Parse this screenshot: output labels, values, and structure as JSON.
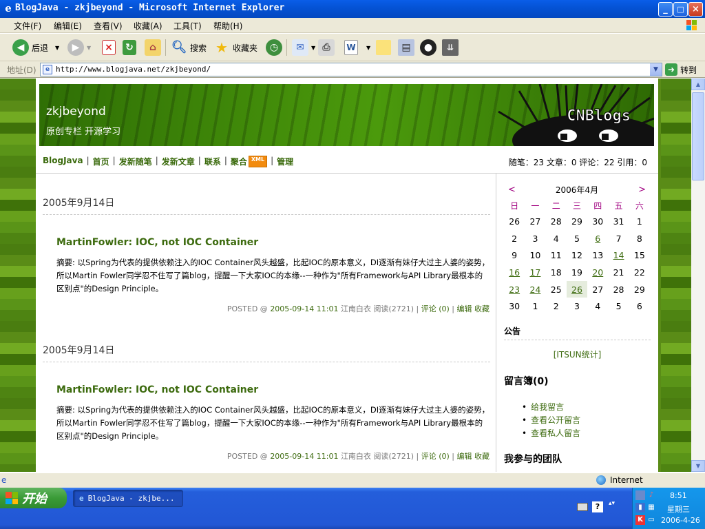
{
  "window": {
    "title": "BlogJava - zkjbeyond - Microsoft Internet Explorer",
    "controls": {
      "minimize": "_",
      "maximize": "□",
      "close": "×"
    }
  },
  "menu": [
    "文件(F)",
    "编辑(E)",
    "查看(V)",
    "收藏(A)",
    "工具(T)",
    "帮助(H)"
  ],
  "toolbar": {
    "back": "后退",
    "search": "搜索",
    "favorites": "收藏夹"
  },
  "address": {
    "label": "地址(D)",
    "url": "http://www.blogjava.net/zkjbeyond/",
    "go": "转到"
  },
  "blog": {
    "name": "zkjbeyond",
    "subtitle": "原创专栏 开源学习",
    "logo": "CNBlogs",
    "nav": [
      "BlogJava",
      "首页",
      "发新随笔",
      "发新文章",
      "联系",
      "聚合",
      "管理"
    ],
    "xml_badge": "XML",
    "stats": "随笔：23 文章：0 评论：22 引用：0"
  },
  "posts": [
    {
      "date": "2005年9月14日",
      "title": "MartinFowler: IOC, not IOC Container",
      "summary": "摘要: 以Spring为代表的提供依赖注入的IOC  Container风头越盛，比起IOC的原本意义，DI逐渐有妹仔大过主人婆的姿势，所以Martin Fowler同学忍不住写了篇blog，提醒一下大家IOC的本缘--一种作为\"所有Framework与API Library最根本的区别点\"的Design Principle。",
      "posted": "POSTED @",
      "time": "2005-09-14 11:01",
      "author": "江南白衣",
      "reads": "阅读(2721)",
      "comments": "评论  (0)",
      "edit": "编辑",
      "fav": "收藏"
    },
    {
      "date": "2005年9月14日",
      "title": "MartinFowler: IOC, not IOC Container",
      "summary": "摘要: 以Spring为代表的提供依赖注入的IOC  Container风头越盛，比起IOC的原本意义，DI逐渐有妹仔大过主人婆的姿势，所以Martin Fowler同学忍不住写了篇blog，提醒一下大家IOC的本缘--一种作为\"所有Framework与API Library最根本的区别点\"的Design Principle。",
      "posted": "POSTED @",
      "time": "2005-09-14 11:01",
      "author": "江南白衣",
      "reads": "阅读(2721)",
      "comments": "评论  (0)",
      "edit": "编辑",
      "fav": "收藏"
    }
  ],
  "calendar": {
    "prev": "<",
    "next": ">",
    "month": "2006年4月",
    "weekdays": [
      "日",
      "一",
      "二",
      "三",
      "四",
      "五",
      "六"
    ],
    "weeks": [
      [
        "26",
        "27",
        "28",
        "29",
        "30",
        "31",
        "1"
      ],
      [
        "2",
        "3",
        "4",
        "5",
        "6",
        "7",
        "8"
      ],
      [
        "9",
        "10",
        "11",
        "12",
        "13",
        "14",
        "15"
      ],
      [
        "16",
        "17",
        "18",
        "19",
        "20",
        "21",
        "22"
      ],
      [
        "23",
        "24",
        "25",
        "26",
        "27",
        "28",
        "29"
      ],
      [
        "30",
        "1",
        "2",
        "3",
        "4",
        "5",
        "6"
      ]
    ],
    "linked_days": [
      "6",
      "14",
      "16",
      "17",
      "20",
      "23",
      "24"
    ],
    "today": "26"
  },
  "sidebar": {
    "notice_title": "公告",
    "notice_link": "[ITSUN统计]",
    "guestbook_title": "留言簿(0)",
    "guestbook_links": [
      "给我留言",
      "查看公开留言",
      "查看私人留言"
    ],
    "teams_title": "我参与的团队"
  },
  "status": {
    "zone": "Internet"
  },
  "taskbar": {
    "start": "开始",
    "task": "BlogJava - zkjbe...",
    "time": "8:51",
    "weekday": "星期三",
    "date": "2006-4-26"
  },
  "colors": {
    "accent_green": "#3d6b0f",
    "calendar_weekday": "#a00080",
    "xp_blue": "#245edb"
  }
}
